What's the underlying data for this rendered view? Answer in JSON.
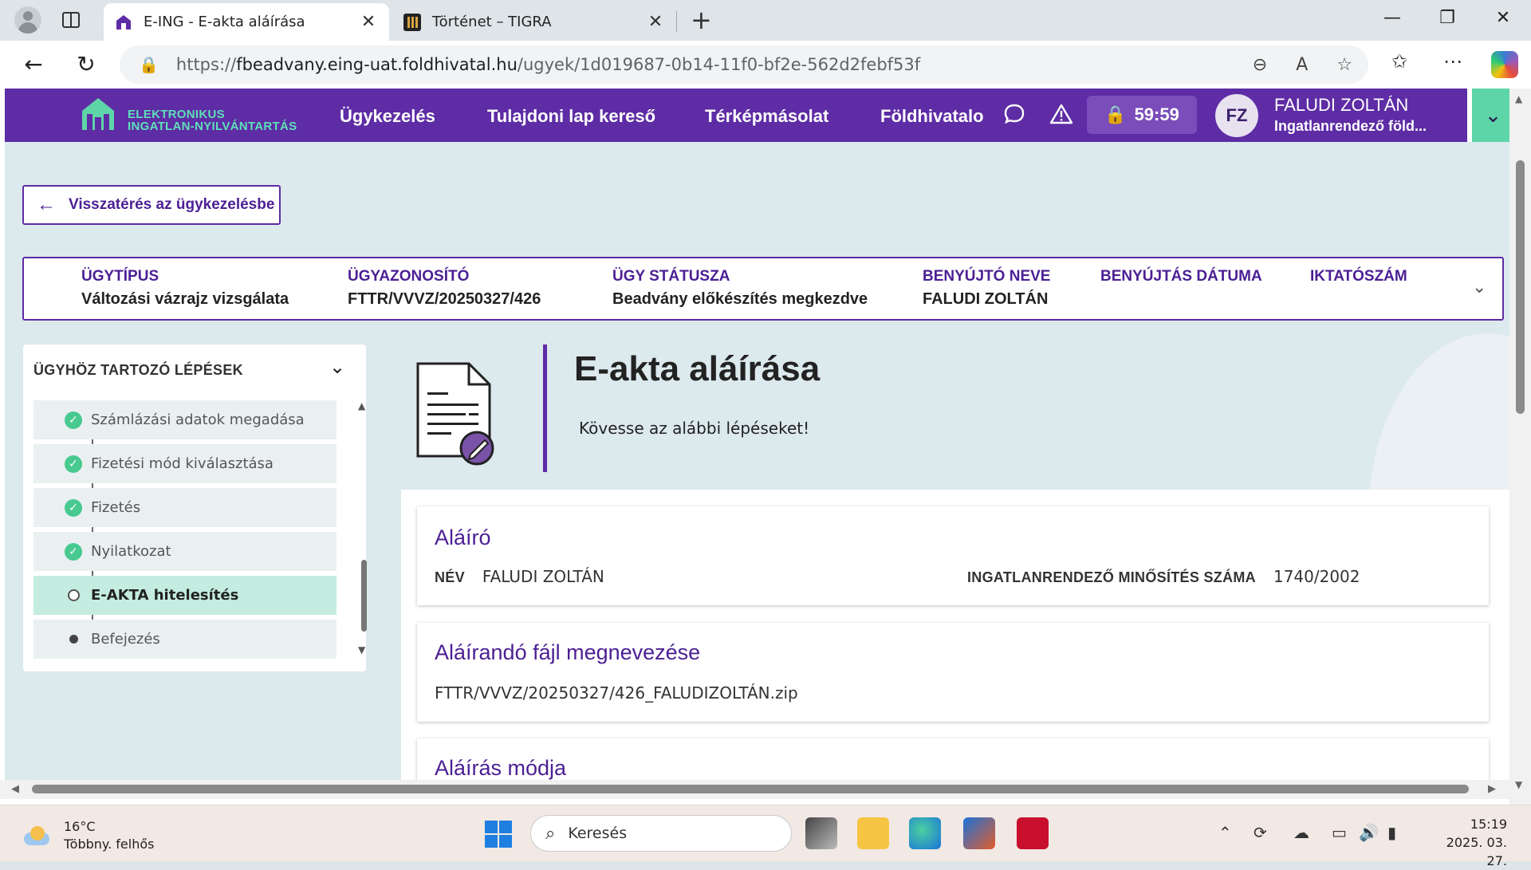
{
  "browser": {
    "tabs": [
      {
        "title": "E-ING - E-akta aláírása",
        "active": true
      },
      {
        "title": "Történet – TIGRA",
        "active": false
      }
    ],
    "url_prefix": "https://",
    "url_host": "fbeadvany.eing-uat.foldhivatal.hu",
    "url_path": "/ugyek/1d019687-0b14-11f0-bf2e-562d2febf53f"
  },
  "app": {
    "logo_line1": "ELEKTRONIKUS",
    "logo_line2": "INGATLAN-NYILVÁNTARTÁS",
    "nav": [
      "Ügykezelés",
      "Tulajdoni lap kereső",
      "Térképmásolat",
      "Földhivatalo"
    ],
    "timer": "59:59",
    "avatar_initials": "FZ",
    "user_name": "FALUDI ZOLTÁN",
    "user_role": "Ingatlanrendező föld...",
    "accent": "#5e2ca5",
    "green": "#5ed5a8"
  },
  "back_button": "Visszatérés az ügykezelésbe",
  "case_info": [
    {
      "label": "ÜGYTÍPUS",
      "value": "Változási vázrajz vizsgálata"
    },
    {
      "label": "ÜGYAZONOSÍTÓ",
      "value": "FTTR/VVVZ/20250327/426"
    },
    {
      "label": "ÜGY STÁTUSZA",
      "value": "Beadvány előkészítés megkezdve"
    },
    {
      "label": "BENYÚJTÓ NEVE",
      "value": "FALUDI ZOLTÁN"
    },
    {
      "label": "BENYÚJTÁS DÁTUMA",
      "value": ""
    },
    {
      "label": "IKTATÓSZÁM",
      "value": ""
    }
  ],
  "steps": {
    "heading": "ÜGYHÖZ TARTOZÓ LÉPÉSEK",
    "items": [
      {
        "label": "Számlázási adatok megadása",
        "state": "done"
      },
      {
        "label": "Fizetési mód kiválasztása",
        "state": "done"
      },
      {
        "label": "Fizetés",
        "state": "done"
      },
      {
        "label": "Nyilatkozat",
        "state": "done"
      },
      {
        "label": "E-AKTA hitelesítés",
        "state": "current"
      },
      {
        "label": "Befejezés",
        "state": "pending"
      }
    ]
  },
  "page": {
    "title": "E-akta aláírása",
    "subtitle": "Kövesse az alábbi lépéseket!"
  },
  "signer_card": {
    "heading": "Aláíró",
    "name_label": "NÉV",
    "name_value": "FALUDI ZOLTÁN",
    "cert_label": "INGATLANRENDEZŐ MINŐSÍTÉS SZÁMA",
    "cert_value": "1740/2002"
  },
  "file_card": {
    "heading": "Aláírandó fájl megnevezése",
    "file_name": "FTTR/VVVZ/20250327/426_FALUDIZOLTÁN.zip"
  },
  "method_card": {
    "heading": "Aláírás módja"
  },
  "taskbar": {
    "temp": "16°C",
    "weather": "Többny. felhős",
    "search_placeholder": "Keresés",
    "time": "15:19",
    "date": "2025. 03. 27."
  }
}
